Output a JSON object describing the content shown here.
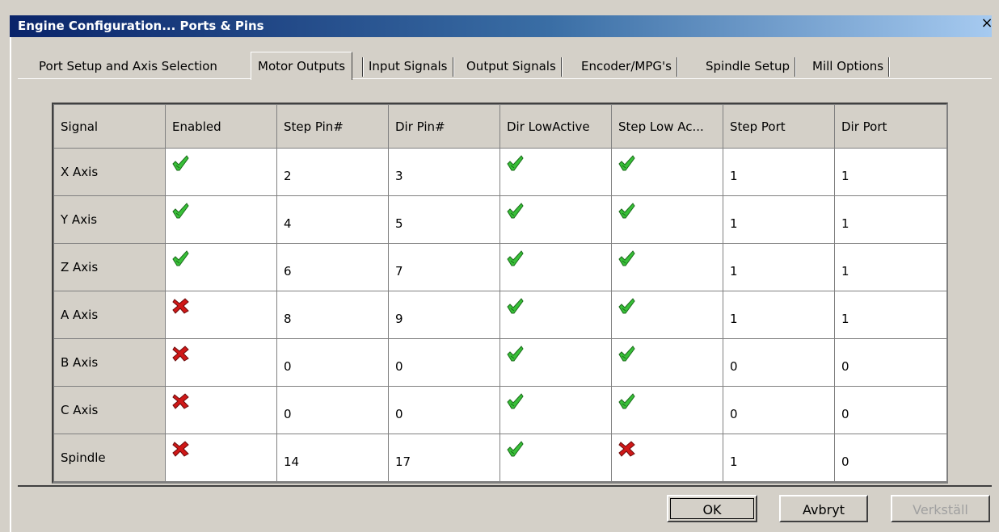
{
  "window": {
    "title": "Engine Configuration... Ports & Pins",
    "close_glyph": "×"
  },
  "tabs": [
    {
      "label": "Port Setup and Axis Selection"
    },
    {
      "label": "Motor Outputs"
    },
    {
      "label": "Input Signals"
    },
    {
      "label": "Output Signals"
    },
    {
      "label": "Encoder/MPG's"
    },
    {
      "label": "Spindle Setup"
    },
    {
      "label": "Mill Options"
    }
  ],
  "active_tab": "Motor Outputs",
  "table": {
    "columns": [
      "Signal",
      "Enabled",
      "Step Pin#",
      "Dir Pin#",
      "Dir LowActive",
      "Step Low Ac...",
      "Step Port",
      "Dir Port"
    ],
    "rows": [
      {
        "signal": "X Axis",
        "enabled": "check-icon",
        "step_pin": "2",
        "dir_pin": "3",
        "dir_low_active": "check-icon",
        "step_low_active": "check-icon",
        "step_port": "1",
        "dir_port": "1"
      },
      {
        "signal": "Y Axis",
        "enabled": "check-icon",
        "step_pin": "4",
        "dir_pin": "5",
        "dir_low_active": "check-icon",
        "step_low_active": "check-icon",
        "step_port": "1",
        "dir_port": "1"
      },
      {
        "signal": "Z Axis",
        "enabled": "check-icon",
        "step_pin": "6",
        "dir_pin": "7",
        "dir_low_active": "check-icon",
        "step_low_active": "check-icon",
        "step_port": "1",
        "dir_port": "1"
      },
      {
        "signal": "A Axis",
        "enabled": "cross-icon",
        "step_pin": "8",
        "dir_pin": "9",
        "dir_low_active": "check-icon",
        "step_low_active": "check-icon",
        "step_port": "1",
        "dir_port": "1"
      },
      {
        "signal": "B Axis",
        "enabled": "cross-icon",
        "step_pin": "0",
        "dir_pin": "0",
        "dir_low_active": "check-icon",
        "step_low_active": "check-icon",
        "step_port": "0",
        "dir_port": "0"
      },
      {
        "signal": "C Axis",
        "enabled": "cross-icon",
        "step_pin": "0",
        "dir_pin": "0",
        "dir_low_active": "check-icon",
        "step_low_active": "check-icon",
        "step_port": "0",
        "dir_port": "0"
      },
      {
        "signal": "Spindle",
        "enabled": "cross-icon",
        "step_pin": "14",
        "dir_pin": "17",
        "dir_low_active": "check-icon",
        "step_low_active": "cross-icon",
        "step_port": "1",
        "dir_port": "0"
      }
    ]
  },
  "buttons": {
    "ok": "OK",
    "cancel": "Avbryt",
    "apply": "Verkställ"
  },
  "colors": {
    "check": "#38c038",
    "cross": "#d01818",
    "titlebar": "#0a246a"
  }
}
